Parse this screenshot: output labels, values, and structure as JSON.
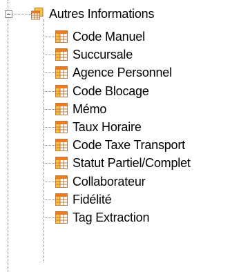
{
  "tree": {
    "root": {
      "label": "Autres Informations",
      "expanded": true,
      "icon": "table-group-icon"
    },
    "children": [
      {
        "label": "Code Manuel",
        "icon": "table-field-icon"
      },
      {
        "label": "Succursale",
        "icon": "table-field-icon"
      },
      {
        "label": "Agence Personnel",
        "icon": "table-field-icon"
      },
      {
        "label": "Code Blocage",
        "icon": "table-field-icon"
      },
      {
        "label": "Mémo",
        "icon": "table-field-icon"
      },
      {
        "label": "Taux Horaire",
        "icon": "table-field-icon"
      },
      {
        "label": "Code Taxe Transport",
        "icon": "table-field-icon"
      },
      {
        "label": "Statut Partiel/Complet",
        "icon": "table-field-icon"
      },
      {
        "label": "Collaborateur",
        "icon": "table-field-icon"
      },
      {
        "label": "Fidélité",
        "icon": "table-field-icon"
      },
      {
        "label": "Tag Extraction",
        "icon": "table-field-icon"
      }
    ]
  },
  "colors": {
    "icon_orange": "#f07a1e",
    "icon_yellow": "#f5c242",
    "icon_border": "#c07a3a",
    "connector": "#808080"
  }
}
